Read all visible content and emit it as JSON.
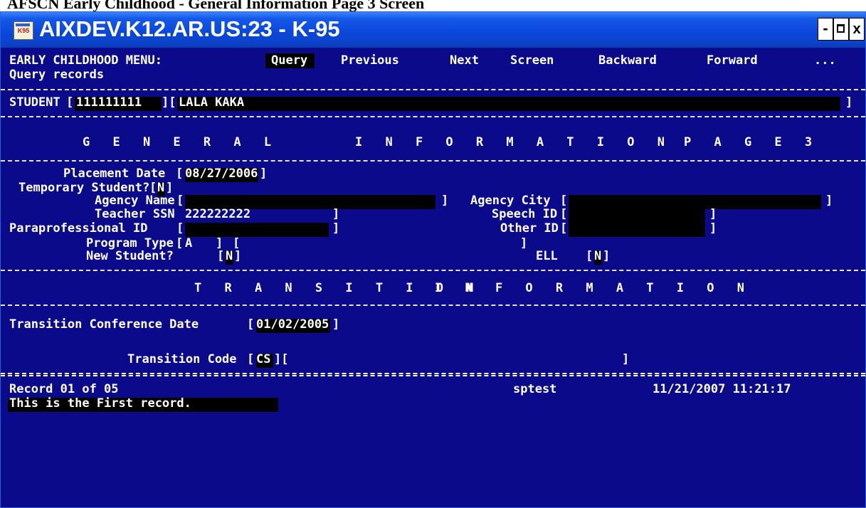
{
  "caption": "AFSCN Early Childhood - General Information Page 3 Screen",
  "window": {
    "icon_label": "K95",
    "title": "AIXDEV.K12.AR.US:23 - K-95",
    "min_label": "-",
    "close_label": "x"
  },
  "menu": {
    "label": "EARLY CHILDHOOD MENU:",
    "items": [
      "Query",
      "Previous",
      "Next",
      "Screen",
      "Backward",
      "Forward",
      "..."
    ],
    "selected": "Query",
    "help": "Query records"
  },
  "student": {
    "label": "STUDENT",
    "id": "111111111",
    "name": "LALA KAKA"
  },
  "section1": {
    "left": "G E N E R A L",
    "center": "I N F O R M A T I O N",
    "right": "P A G E 3"
  },
  "fields": {
    "placement_date_label": "Placement Date",
    "placement_date": "08/27/2006",
    "temporary_label": "Temporary Student?",
    "temporary": "N",
    "agency_name_label": "Agency Name",
    "agency_name": "",
    "agency_city_label": "Agency City",
    "agency_city": "",
    "teacher_ssn_label": "Teacher SSN",
    "teacher_ssn": "222222222",
    "speech_id_label": "Speech ID",
    "speech_id": "",
    "para_id_label": "Paraprofessional ID",
    "para_id": "",
    "other_id_label": "Other ID",
    "other_id": "",
    "program_type_label": "Program Type",
    "program_type": "A",
    "program_desc": "",
    "new_student_label": "New Student?",
    "new_student": "N",
    "ell_label": "ELL",
    "ell": "N"
  },
  "section2": {
    "left": "T R A N S I T I O N",
    "right": "I N F O R M A T I O N"
  },
  "transition": {
    "conf_date_label": "Transition Conference Date",
    "conf_date": "01/02/2005",
    "code_label": "Transition Code",
    "code": "CS",
    "code_desc": ""
  },
  "status": {
    "record": "Record 01 of 05",
    "user": "sptest",
    "datetime": "11/21/2007 11:21:17",
    "message": "This is the First record."
  }
}
